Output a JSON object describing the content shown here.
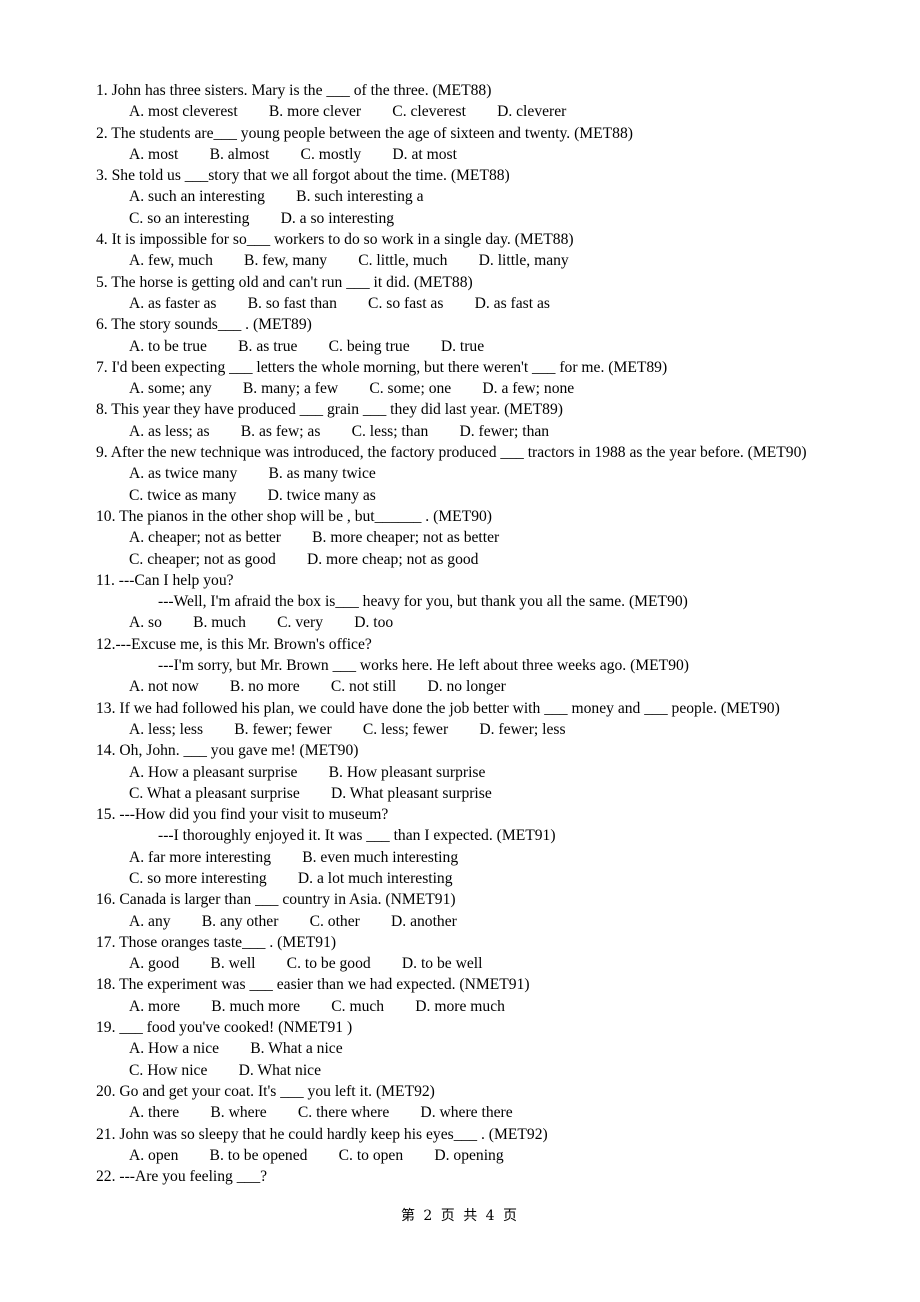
{
  "document": {
    "footer": "第 2 页 共 4 页",
    "page_number": "2",
    "total_pages": "4",
    "background_color": "#ffffff",
    "text_color": "#000000"
  },
  "questions": [
    {
      "stem": "1. John has three sisters. Mary is the ___ of the three. (MET88)",
      "option_lines": [
        "A. most cleverest        B. more clever        C. cleverest        D. cleverer"
      ]
    },
    {
      "stem": "2. The students are___ young people between the age of sixteen and twenty. (MET88)",
      "option_lines": [
        "A. most        B. almost        C. mostly        D. at most"
      ]
    },
    {
      "stem": "3. She told us ___story that we all forgot about the time. (MET88)",
      "option_lines": [
        "A. such an interesting        B. such interesting a",
        "C. so an interesting        D. a so interesting"
      ]
    },
    {
      "stem": "4. It is impossible for so___ workers to do so work in a single day. (MET88)",
      "option_lines": [
        "A. few, much        B. few, many        C. little, much        D. little, many"
      ]
    },
    {
      "stem": "5. The horse is getting old and can't run ___ it did. (MET88)",
      "option_lines": [
        "A. as faster as        B. so fast than        C. so fast as        D. as fast as"
      ]
    },
    {
      "stem": "6. The story sounds___ . (MET89)",
      "option_lines": [
        "A. to be true        B. as true        C. being true        D. true"
      ]
    },
    {
      "stem": "7. I'd been expecting ___ letters the whole morning, but there weren't ___ for me. (MET89)",
      "option_lines": [
        "A. some; any        B. many; a few        C. some; one        D. a few; none"
      ]
    },
    {
      "stem": "8. This year they have produced ___ grain ___ they did last year. (MET89)",
      "option_lines": [
        "A. as less; as        B. as few; as        C. less; than        D. fewer; than"
      ]
    },
    {
      "stem": "9. After the new technique was introduced, the factory produced ___ tractors in 1988 as the year before. (MET90)",
      "option_lines": [
        "A. as twice many        B. as many twice",
        "C. twice as many        D. twice many as"
      ]
    },
    {
      "stem": "10. The pianos in the other shop will be , but______ . (MET90)",
      "option_lines": [
        "A. cheaper; not as better        B. more cheaper; not as better",
        "C. cheaper; not as good        D. more cheap; not as good"
      ]
    },
    {
      "stem": "11. ---Can I help you?",
      "reply_lines": [
        "---Well, I'm afraid the box is___ heavy for you, but thank you all the same. (MET90)"
      ],
      "option_lines": [
        "A. so        B. much        C. very        D. too"
      ]
    },
    {
      "stem": "12.---Excuse me, is this Mr. Brown's office?",
      "reply_lines": [
        "---I'm sorry, but Mr. Brown ___ works here. He left about three weeks ago. (MET90)"
      ],
      "option_lines": [
        "A. not now        B. no more        C. not still        D. no longer"
      ]
    },
    {
      "stem": "13. If we had followed his plan, we could have done the job better with ___ money and ___ people. (MET90)",
      "option_lines": [
        "A. less; less        B. fewer; fewer        C. less; fewer        D. fewer; less"
      ]
    },
    {
      "stem": "14. Oh, John. ___ you gave me! (MET90)",
      "option_lines": [
        "A. How a pleasant surprise        B. How pleasant surprise",
        "C. What a pleasant surprise        D. What pleasant surprise"
      ]
    },
    {
      "stem": "15. ---How did you find your visit to museum?",
      "reply_lines": [
        "---I thoroughly enjoyed it. It was ___ than I expected. (MET91)"
      ],
      "option_lines": [
        "A. far more interesting        B. even much interesting",
        "C. so more interesting        D. a lot much interesting"
      ]
    },
    {
      "stem": "16. Canada is larger than ___ country in Asia. (NMET91)",
      "option_lines": [
        "A. any        B. any other        C. other        D. another"
      ]
    },
    {
      "stem": "17. Those oranges taste___ . (MET91)",
      "option_lines": [
        "A. good        B. well        C. to be good        D. to be well"
      ]
    },
    {
      "stem": "18. The experiment was ___ easier than we had expected. (NMET91)",
      "option_lines": [
        "A. more        B. much more        C. much        D. more much"
      ]
    },
    {
      "stem": "19. ___ food you've cooked! (NMET91 )",
      "option_lines": [
        "A. How a nice        B. What a nice",
        "C. How nice        D. What nice"
      ]
    },
    {
      "stem": "20. Go and get your coat. It's ___ you left it. (MET92)",
      "option_lines": [
        "A. there        B. where        C. there where        D. where there"
      ]
    },
    {
      "stem": "21. John was so sleepy that he could hardly keep his eyes___ . (MET92)",
      "option_lines": [
        "A. open        B. to be opened        C. to open        D. opening"
      ]
    },
    {
      "stem": "22. ---Are you feeling ___?",
      "option_lines": []
    }
  ]
}
